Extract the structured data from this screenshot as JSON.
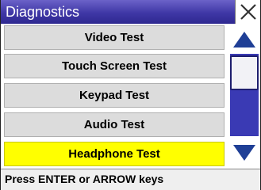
{
  "window": {
    "title": "Diagnostics",
    "close_icon": "close-icon"
  },
  "menu": {
    "items": [
      {
        "label": "Video Test",
        "selected": false
      },
      {
        "label": "Touch Screen Test",
        "selected": false
      },
      {
        "label": "Keypad Test",
        "selected": false
      },
      {
        "label": "Audio Test",
        "selected": false
      },
      {
        "label": "Headphone Test",
        "selected": true
      }
    ]
  },
  "scrollbar": {
    "up_icon": "triangle-up-icon",
    "down_icon": "triangle-down-icon"
  },
  "status_bar": {
    "text": "Press ENTER or ARROW keys"
  },
  "colors": {
    "titlebar": "#3f37a6",
    "selected_item": "#ffff00",
    "item": "#dcdcdc",
    "scroll_track": "#3a3ab4",
    "scroll_arrow": "#1f3f96"
  }
}
